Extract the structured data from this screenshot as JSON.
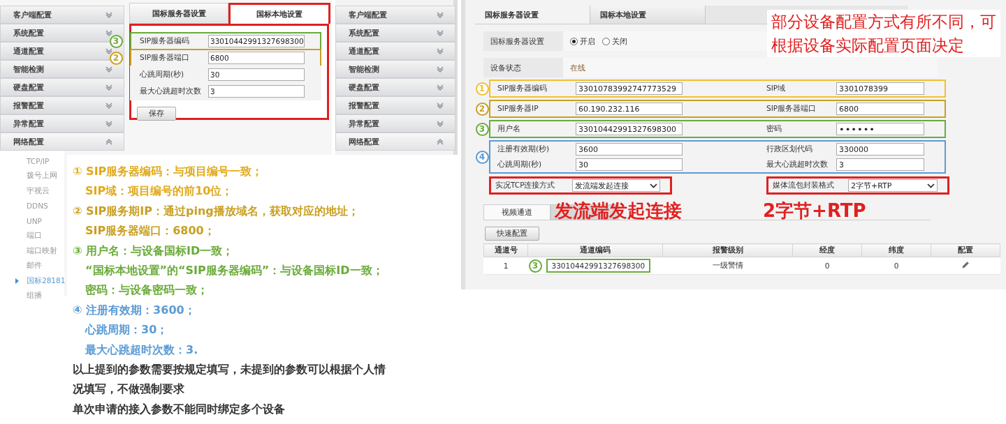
{
  "left_screen": {
    "sidebar": {
      "items": [
        {
          "label": "客户端配置",
          "expanded": false
        },
        {
          "label": "系统配置",
          "expanded": false
        },
        {
          "label": "通道配置",
          "expanded": false
        },
        {
          "label": "智能检测",
          "expanded": false
        },
        {
          "label": "硬盘配置",
          "expanded": false
        },
        {
          "label": "报警配置",
          "expanded": false
        },
        {
          "label": "异常配置",
          "expanded": false
        },
        {
          "label": "网络配置",
          "expanded": true
        }
      ],
      "subitems": [
        {
          "label": "TCP/IP",
          "selected": false
        },
        {
          "label": "拨号上网",
          "selected": false
        },
        {
          "label": "宇视云",
          "selected": false
        },
        {
          "label": "DDNS",
          "selected": false
        },
        {
          "label": "UNP",
          "selected": false
        },
        {
          "label": "端口",
          "selected": false
        },
        {
          "label": "端口映射",
          "selected": false
        },
        {
          "label": "邮件",
          "selected": false
        },
        {
          "label": "国标28181",
          "selected": true
        },
        {
          "label": "组播",
          "selected": false
        }
      ]
    },
    "tabs": [
      {
        "label": "国标服务器设置",
        "selected": false
      },
      {
        "label": "国标本地设置",
        "selected": true
      }
    ],
    "fields": [
      {
        "label": "SIP服务器编码",
        "value": "33010442991327698300",
        "marker": "3",
        "color": "#6aab3a"
      },
      {
        "label": "SIP服务器端口",
        "value": "6800",
        "marker": "2",
        "color": "#c9a022"
      },
      {
        "label": "心跳周期(秒)",
        "value": "30"
      },
      {
        "label": "最大心跳超时次数",
        "value": "3"
      }
    ],
    "save_button": "保存"
  },
  "middle_screen": {
    "sidebar": {
      "items": [
        {
          "label": "客户端配置",
          "expanded": false
        },
        {
          "label": "系统配置",
          "expanded": false
        },
        {
          "label": "通道配置",
          "expanded": false
        },
        {
          "label": "智能检测",
          "expanded": false
        },
        {
          "label": "硬盘配置",
          "expanded": false
        },
        {
          "label": "报警配置",
          "expanded": false
        },
        {
          "label": "异常配置",
          "expanded": false
        },
        {
          "label": "网络配置",
          "expanded": true
        }
      ]
    }
  },
  "right_screen": {
    "tabs": [
      {
        "label": "国标服务器设置",
        "selected": true
      },
      {
        "label": "国标本地设置",
        "selected": false
      }
    ],
    "server_setting": {
      "label": "国标服务器设置",
      "options": [
        {
          "label": "开启",
          "selected": true
        },
        {
          "label": "关闭",
          "selected": false
        }
      ]
    },
    "device_status": {
      "label": "设备状态",
      "value": "在线"
    },
    "groups": [
      {
        "marker": "1",
        "color": "#f0c030",
        "rows": [
          [
            {
              "kind": "text",
              "label": "SIP服务器编码",
              "value": "33010783992747773529"
            },
            {
              "kind": "text",
              "label": "SIP域",
              "value": "3301078399"
            }
          ]
        ]
      },
      {
        "marker": "2",
        "color": "#c9a022",
        "rows": [
          [
            {
              "kind": "text",
              "label": "SIP服务器IP",
              "value": "60.190.232.116"
            },
            {
              "kind": "text",
              "label": "SIP服务器端口",
              "value": "6800"
            }
          ]
        ]
      },
      {
        "marker": "3",
        "color": "#6aab3a",
        "rows": [
          [
            {
              "kind": "text",
              "label": "用户名",
              "value": "33010442991327698300"
            },
            {
              "kind": "password",
              "label": "密码",
              "value": "••••••"
            }
          ]
        ]
      },
      {
        "marker": "4",
        "color": "#5b9bd5",
        "rows": [
          [
            {
              "kind": "text",
              "label": "注册有效期(秒)",
              "value": "3600"
            },
            {
              "kind": "text",
              "label": "行政区划代码",
              "value": "330000"
            }
          ],
          [
            {
              "kind": "text",
              "label": "心跳周期(秒)",
              "value": "30"
            },
            {
              "kind": "text",
              "label": "最大心跳超时次数",
              "value": "3"
            }
          ]
        ]
      }
    ],
    "stream_settings": [
      {
        "kind": "select",
        "label": "实况TCP连接方式",
        "value": "发流端发起连接"
      },
      {
        "kind": "select",
        "label": "媒体流包封装格式",
        "value": "2字节+RTP"
      }
    ],
    "channel_tabs": [
      {
        "label": "视频通道",
        "selected": true
      }
    ],
    "quick_config_button": "快速配置",
    "channel_table": {
      "columns": [
        "通道号",
        "通道编码",
        "报警级别",
        "经度",
        "纬度",
        "配置"
      ],
      "rows": [
        {
          "cells": [
            "1",
            "33010442991327698300",
            "一级警情",
            "0",
            "0"
          ],
          "marker": "3",
          "color": "#6aab3a"
        }
      ]
    }
  },
  "annotations": {
    "heading": [
      "部分设备配置方式有所不同，可",
      "根据设备实际配置页面决定"
    ],
    "connection_note": "发流端发起连接",
    "format_note": "2字节+RTP"
  },
  "notes": [
    {
      "color": "#e0aa1a",
      "lines": [
        "① SIP服务器编码：与项目编号一致；",
        "SIP域：项目编号的前10位；"
      ]
    },
    {
      "color": "#c9a022",
      "lines": [
        "② SIP服务期IP：通过ping播放域名，获取对应的地址；",
        "SIP服务器端口：6800；"
      ]
    },
    {
      "color": "#6aab3a",
      "lines": [
        "③ 用户名：与设备国标ID一致；",
        "“国标本地设置”的“SIP服务器编码”：与设备国标ID一致；",
        "密码：与设备密码一致；"
      ]
    },
    {
      "color": "#5b9bd5",
      "lines": [
        "④ 注册有效期：3600；",
        "心跳周期：30；",
        "最大心跳超时次数：3."
      ]
    }
  ],
  "remarks": [
    "以上提到的参数需要按规定填写，未提到的参数可以根据个人情况填写，不做强制要求",
    "单次申请的接入参数不能同时绑定多个设备"
  ]
}
